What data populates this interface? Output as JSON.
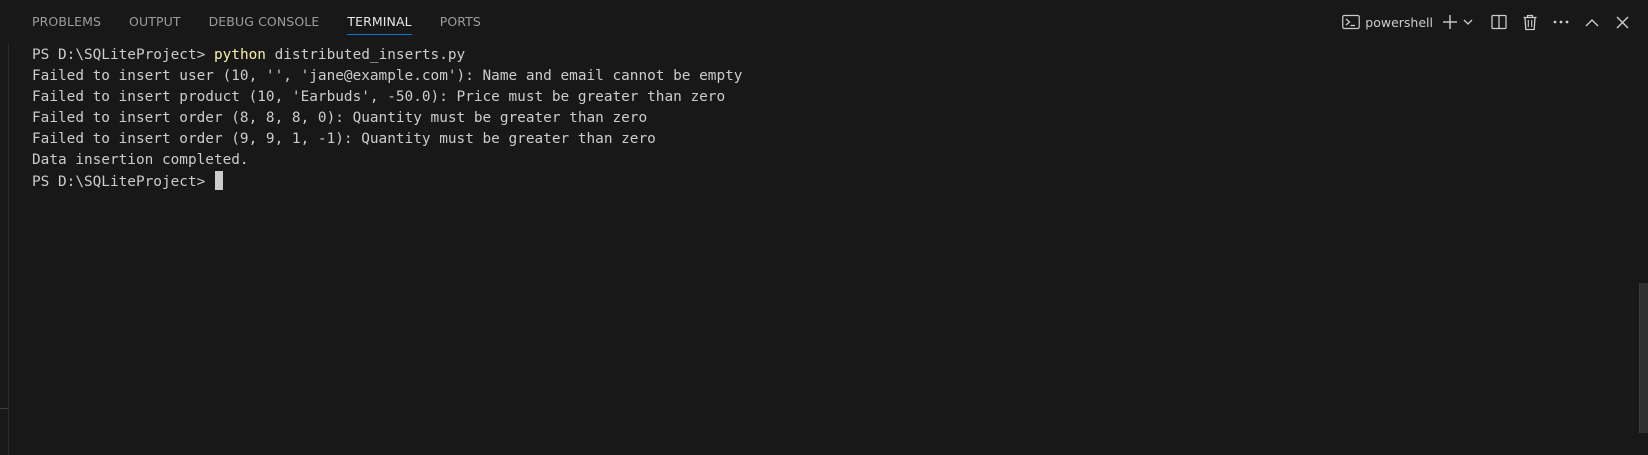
{
  "panel": {
    "tabs": [
      {
        "label": "PROBLEMS"
      },
      {
        "label": "OUTPUT"
      },
      {
        "label": "DEBUG CONSOLE"
      },
      {
        "label": "TERMINAL",
        "active": true
      },
      {
        "label": "PORTS"
      }
    ],
    "terminal_profile": "powershell",
    "actions": [
      "terminal-icon",
      "add-icon",
      "chevron-down-icon",
      "split-icon",
      "trash-icon",
      "more-icon",
      "chevron-up-icon",
      "close-icon"
    ]
  },
  "terminal": {
    "prompt": "PS D:\\SQLiteProject>",
    "command_keyword": "python",
    "command_arg": "distributed_inserts.py",
    "output": [
      "Failed to insert user (10, '', 'jane@example.com'): Name and email cannot be empty",
      "Failed to insert product (10, 'Earbuds', -50.0): Price must be greater than zero",
      "Failed to insert order (8, 8, 8, 0): Quantity must be greater than zero",
      "Failed to insert order (9, 9, 1, -1): Quantity must be greater than zero",
      "Data insertion completed."
    ]
  },
  "colors": {
    "background": "#181818",
    "text": "#cccccc",
    "command": "#f9f1a5",
    "accent": "#0078d4"
  }
}
